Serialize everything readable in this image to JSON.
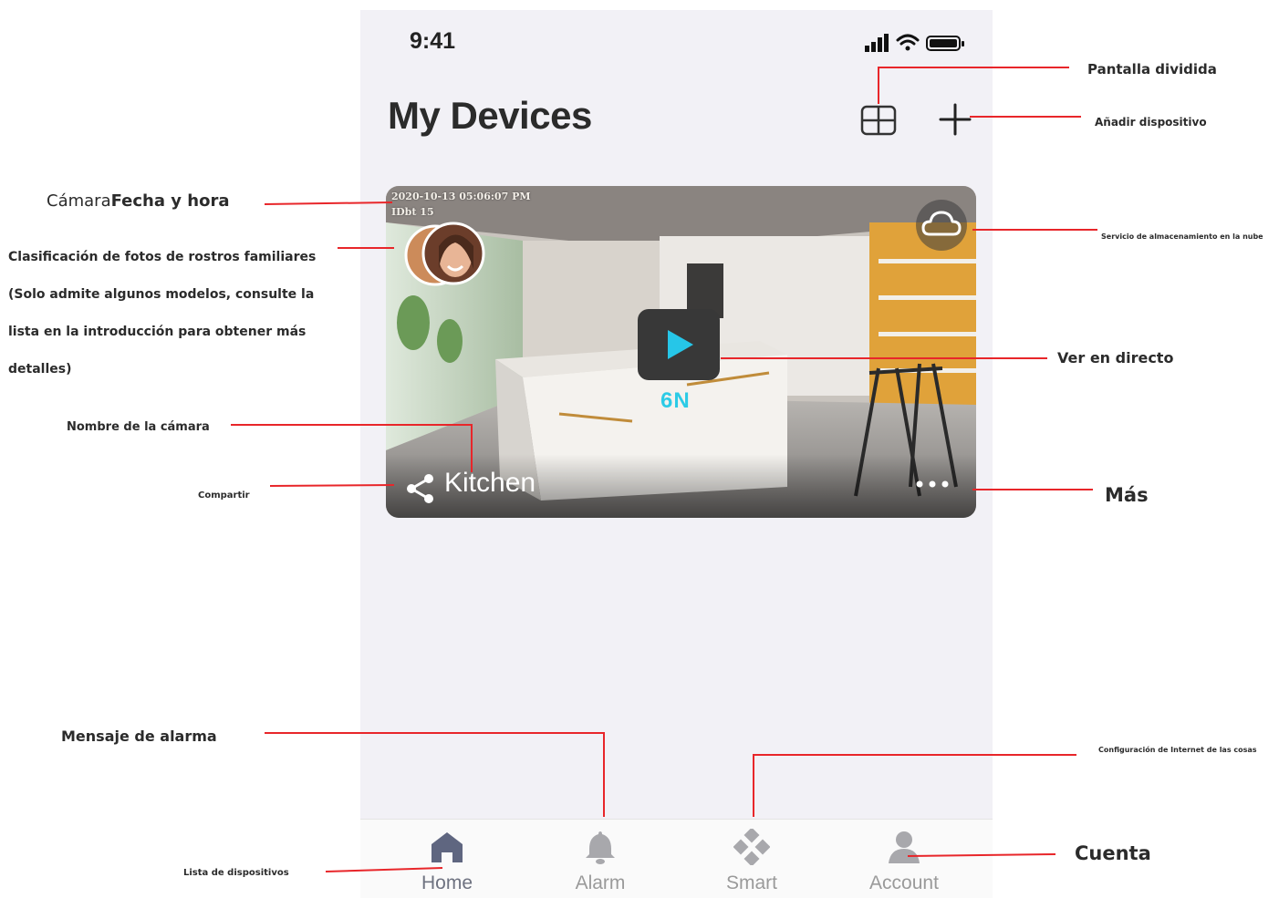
{
  "phone": {
    "status_time": "9:41",
    "page_title": "My Devices"
  },
  "camera_card": {
    "date_time": "2020-10-13 05:06:07 PM",
    "date_sub": "IDbt 15",
    "resolution_label": "6N",
    "camera_name": "Kitchen"
  },
  "tabs": [
    {
      "label": "Home",
      "icon": "home-icon",
      "active": true
    },
    {
      "label": "Alarm",
      "icon": "bell-icon",
      "active": false
    },
    {
      "label": "Smart",
      "icon": "smart-icon",
      "active": false
    },
    {
      "label": "Account",
      "icon": "person-icon",
      "active": false
    }
  ],
  "annotations": {
    "split_screen": "Pantalla dividida",
    "add_device": "Añadir dispositivo",
    "camera_date_prefix": "Cámara",
    "camera_date_bold": "Fecha y hora",
    "face_classification": "Clasificación de fotos de rostros familiares (Solo admite algunos modelos, consulte la lista en la introducción para obtener más detalles)",
    "cloud_storage": "Servicio de almacenamiento en la nube",
    "live_view": "Ver en directo",
    "camera_name": "Nombre de la cámara",
    "share": "Compartir",
    "more": "Más",
    "alarm_message": "Mensaje de alarma",
    "iot_config": "Configuración de Internet de las cosas",
    "device_list": "Lista de dispositivos",
    "account": "Cuenta"
  },
  "colors": {
    "annotation_line": "#e8262a",
    "phone_background": "#f2f1f6",
    "play_icon": "#26c6e8"
  }
}
